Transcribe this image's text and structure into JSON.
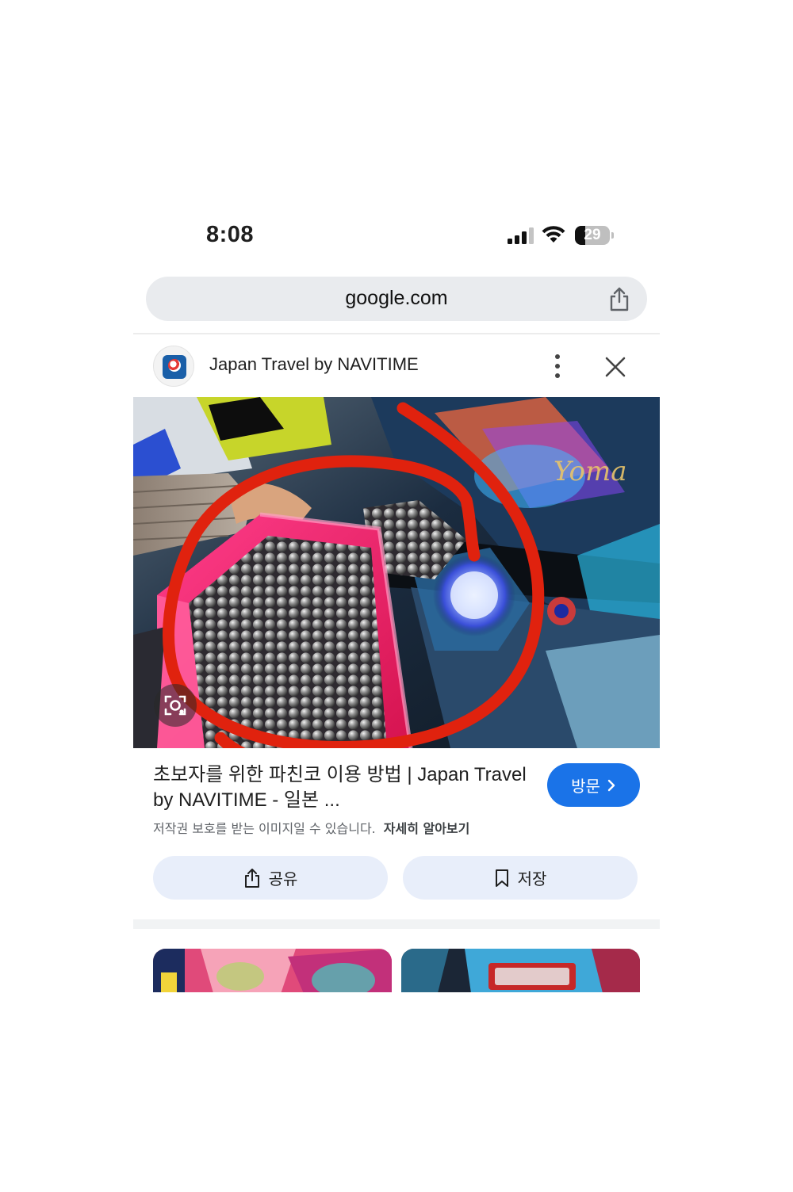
{
  "status_bar": {
    "time": "8:08",
    "battery_level": "29",
    "battery_fraction": 0.29
  },
  "browser": {
    "url": "google.com",
    "share_icon": "share-icon"
  },
  "result": {
    "source_name": "Japan Travel by NAVITIME",
    "more_icon": "more-vert-icon",
    "close_icon": "close-icon",
    "title": "초보자를 위한 파친코 이용 방법 | Japan Travel by NAVITIME - 일본 ...",
    "visit_label": "방문",
    "copyright_notice": "저작권 보호를 받는 이미지일 수 있습니다.",
    "learn_more": "자세히 알아보기",
    "share_label": "공유",
    "save_label": "저장"
  },
  "colors": {
    "accent": "#1a73e8",
    "action_button_bg": "#e8eefa",
    "url_bar_bg": "#e9ebee",
    "annotation_circle": "#e0220e"
  }
}
